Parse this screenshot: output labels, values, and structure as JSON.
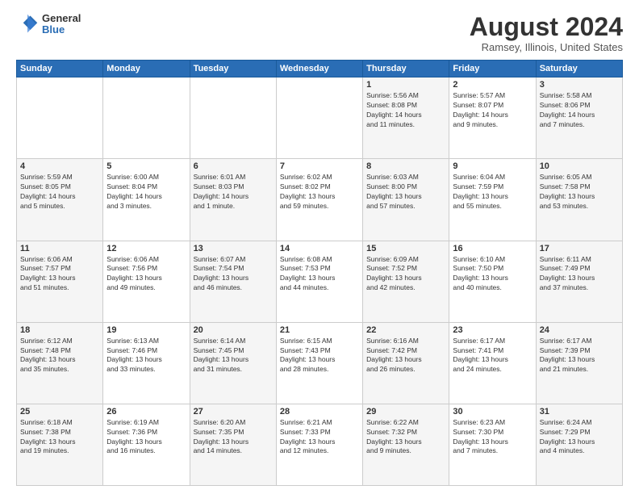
{
  "logo": {
    "general": "General",
    "blue": "Blue"
  },
  "title": {
    "main": "August 2024",
    "sub": "Ramsey, Illinois, United States"
  },
  "calendar": {
    "days_header": [
      "Sunday",
      "Monday",
      "Tuesday",
      "Wednesday",
      "Thursday",
      "Friday",
      "Saturday"
    ],
    "weeks": [
      [
        {
          "day": "",
          "info": ""
        },
        {
          "day": "",
          "info": ""
        },
        {
          "day": "",
          "info": ""
        },
        {
          "day": "",
          "info": ""
        },
        {
          "day": "1",
          "info": "Sunrise: 5:56 AM\nSunset: 8:08 PM\nDaylight: 14 hours\nand 11 minutes."
        },
        {
          "day": "2",
          "info": "Sunrise: 5:57 AM\nSunset: 8:07 PM\nDaylight: 14 hours\nand 9 minutes."
        },
        {
          "day": "3",
          "info": "Sunrise: 5:58 AM\nSunset: 8:06 PM\nDaylight: 14 hours\nand 7 minutes."
        }
      ],
      [
        {
          "day": "4",
          "info": "Sunrise: 5:59 AM\nSunset: 8:05 PM\nDaylight: 14 hours\nand 5 minutes."
        },
        {
          "day": "5",
          "info": "Sunrise: 6:00 AM\nSunset: 8:04 PM\nDaylight: 14 hours\nand 3 minutes."
        },
        {
          "day": "6",
          "info": "Sunrise: 6:01 AM\nSunset: 8:03 PM\nDaylight: 14 hours\nand 1 minute."
        },
        {
          "day": "7",
          "info": "Sunrise: 6:02 AM\nSunset: 8:02 PM\nDaylight: 13 hours\nand 59 minutes."
        },
        {
          "day": "8",
          "info": "Sunrise: 6:03 AM\nSunset: 8:00 PM\nDaylight: 13 hours\nand 57 minutes."
        },
        {
          "day": "9",
          "info": "Sunrise: 6:04 AM\nSunset: 7:59 PM\nDaylight: 13 hours\nand 55 minutes."
        },
        {
          "day": "10",
          "info": "Sunrise: 6:05 AM\nSunset: 7:58 PM\nDaylight: 13 hours\nand 53 minutes."
        }
      ],
      [
        {
          "day": "11",
          "info": "Sunrise: 6:06 AM\nSunset: 7:57 PM\nDaylight: 13 hours\nand 51 minutes."
        },
        {
          "day": "12",
          "info": "Sunrise: 6:06 AM\nSunset: 7:56 PM\nDaylight: 13 hours\nand 49 minutes."
        },
        {
          "day": "13",
          "info": "Sunrise: 6:07 AM\nSunset: 7:54 PM\nDaylight: 13 hours\nand 46 minutes."
        },
        {
          "day": "14",
          "info": "Sunrise: 6:08 AM\nSunset: 7:53 PM\nDaylight: 13 hours\nand 44 minutes."
        },
        {
          "day": "15",
          "info": "Sunrise: 6:09 AM\nSunset: 7:52 PM\nDaylight: 13 hours\nand 42 minutes."
        },
        {
          "day": "16",
          "info": "Sunrise: 6:10 AM\nSunset: 7:50 PM\nDaylight: 13 hours\nand 40 minutes."
        },
        {
          "day": "17",
          "info": "Sunrise: 6:11 AM\nSunset: 7:49 PM\nDaylight: 13 hours\nand 37 minutes."
        }
      ],
      [
        {
          "day": "18",
          "info": "Sunrise: 6:12 AM\nSunset: 7:48 PM\nDaylight: 13 hours\nand 35 minutes."
        },
        {
          "day": "19",
          "info": "Sunrise: 6:13 AM\nSunset: 7:46 PM\nDaylight: 13 hours\nand 33 minutes."
        },
        {
          "day": "20",
          "info": "Sunrise: 6:14 AM\nSunset: 7:45 PM\nDaylight: 13 hours\nand 31 minutes."
        },
        {
          "day": "21",
          "info": "Sunrise: 6:15 AM\nSunset: 7:43 PM\nDaylight: 13 hours\nand 28 minutes."
        },
        {
          "day": "22",
          "info": "Sunrise: 6:16 AM\nSunset: 7:42 PM\nDaylight: 13 hours\nand 26 minutes."
        },
        {
          "day": "23",
          "info": "Sunrise: 6:17 AM\nSunset: 7:41 PM\nDaylight: 13 hours\nand 24 minutes."
        },
        {
          "day": "24",
          "info": "Sunrise: 6:17 AM\nSunset: 7:39 PM\nDaylight: 13 hours\nand 21 minutes."
        }
      ],
      [
        {
          "day": "25",
          "info": "Sunrise: 6:18 AM\nSunset: 7:38 PM\nDaylight: 13 hours\nand 19 minutes."
        },
        {
          "day": "26",
          "info": "Sunrise: 6:19 AM\nSunset: 7:36 PM\nDaylight: 13 hours\nand 16 minutes."
        },
        {
          "day": "27",
          "info": "Sunrise: 6:20 AM\nSunset: 7:35 PM\nDaylight: 13 hours\nand 14 minutes."
        },
        {
          "day": "28",
          "info": "Sunrise: 6:21 AM\nSunset: 7:33 PM\nDaylight: 13 hours\nand 12 minutes."
        },
        {
          "day": "29",
          "info": "Sunrise: 6:22 AM\nSunset: 7:32 PM\nDaylight: 13 hours\nand 9 minutes."
        },
        {
          "day": "30",
          "info": "Sunrise: 6:23 AM\nSunset: 7:30 PM\nDaylight: 13 hours\nand 7 minutes."
        },
        {
          "day": "31",
          "info": "Sunrise: 6:24 AM\nSunset: 7:29 PM\nDaylight: 13 hours\nand 4 minutes."
        }
      ]
    ]
  }
}
